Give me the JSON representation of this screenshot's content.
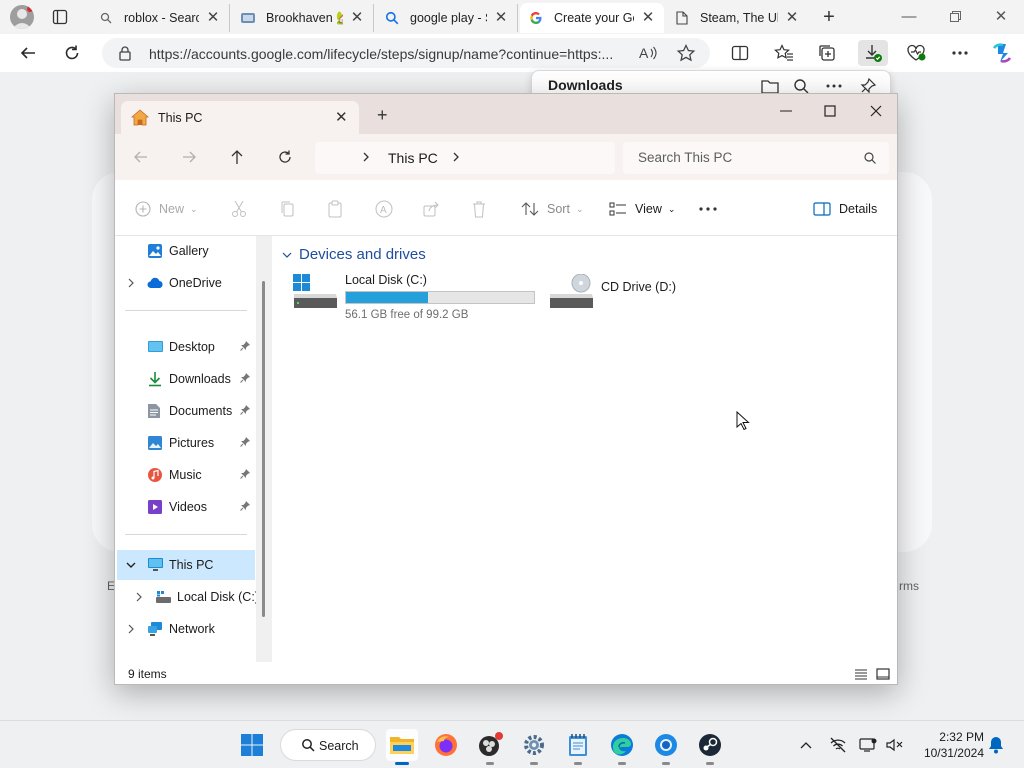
{
  "browser": {
    "tabs": [
      {
        "label": "roblox - Search",
        "icon": "search-icon"
      },
      {
        "label": "Brookhaven 🏡",
        "icon": "brookhaven-icon"
      },
      {
        "label": "google play - Se",
        "icon": "search-icon"
      },
      {
        "label": "Create your Go",
        "icon": "google-icon"
      },
      {
        "label": "Steam, The Ulti",
        "icon": "page-icon"
      }
    ],
    "address": {
      "url": "https://accounts.google.com/lifecycle/steps/signup/name?continue=https:..."
    },
    "downloads": {
      "title": "Downloads"
    },
    "page_fragments": {
      "left": "E",
      "right": "rms"
    }
  },
  "explorer": {
    "tab_title": "This PC",
    "breadcrumb": "This PC",
    "search_placeholder": "Search This PC",
    "commands": {
      "new": "New",
      "sort": "Sort",
      "view": "View",
      "details": "Details"
    },
    "sidebar": {
      "gallery": "Gallery",
      "onedrive": "OneDrive",
      "desktop": "Desktop",
      "downloads": "Downloads",
      "documents": "Documents",
      "pictures": "Pictures",
      "music": "Music",
      "videos": "Videos",
      "this_pc": "This PC",
      "local_disk": "Local Disk (C:)",
      "network": "Network"
    },
    "group_header": "Devices and drives",
    "drives": [
      {
        "name": "Local Disk (C:)",
        "free_text": "56.1 GB free of 99.2 GB",
        "used_fraction": 0.434
      },
      {
        "name": "CD Drive (D:)"
      }
    ],
    "status": {
      "item_count": "9 items"
    }
  },
  "taskbar": {
    "search_label": "Search",
    "time": "2:32 PM",
    "date": "10/31/2024"
  },
  "colors": {
    "accent": "#0067c0",
    "selection": "#cce8ff",
    "drive_fill": "#26a0da",
    "title_bar": "#e9dfdc"
  }
}
